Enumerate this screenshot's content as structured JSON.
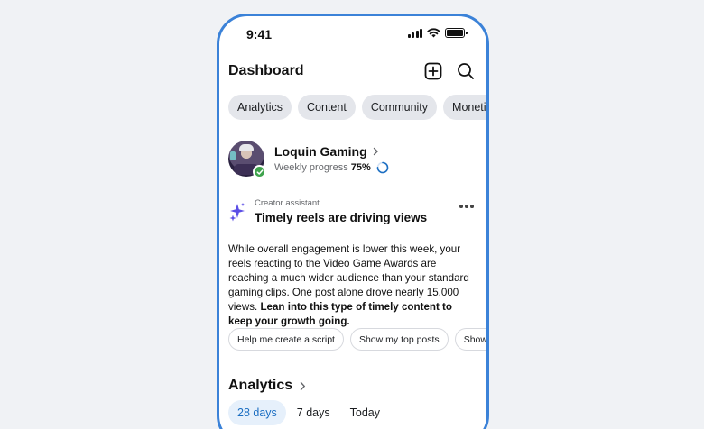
{
  "status_bar": {
    "time": "9:41"
  },
  "header": {
    "title": "Dashboard",
    "add_icon": "plus-square-icon",
    "search_icon": "search-icon"
  },
  "tabs": [
    "Analytics",
    "Content",
    "Community",
    "Monetization"
  ],
  "profile": {
    "name": "Loquin Gaming",
    "progress_label": "Weekly progress",
    "progress_value": "75%",
    "progress_fraction": 0.75,
    "verified_color": "#3fa34d"
  },
  "assistant": {
    "label": "Creator assistant",
    "title": "Timely reels are driving views",
    "body_regular": "While overall engagement is lower this week, your reels reacting to the Video Game Awards are reaching a much wider audience than your standard gaming clips. One post alone drove nearly 15,000 views. ",
    "body_bold": "Lean into this type of timely content to keep your growth going.",
    "suggestions": [
      "Help me create a script",
      "Show my top posts",
      "Show me"
    ]
  },
  "analytics": {
    "title": "Analytics",
    "ranges": [
      "28 days",
      "7 days",
      "Today"
    ],
    "active_range": "28 days"
  },
  "colors": {
    "accent": "#1b6ec2",
    "frame": "#3b82d8",
    "sparkle": "#5b4ee6"
  }
}
